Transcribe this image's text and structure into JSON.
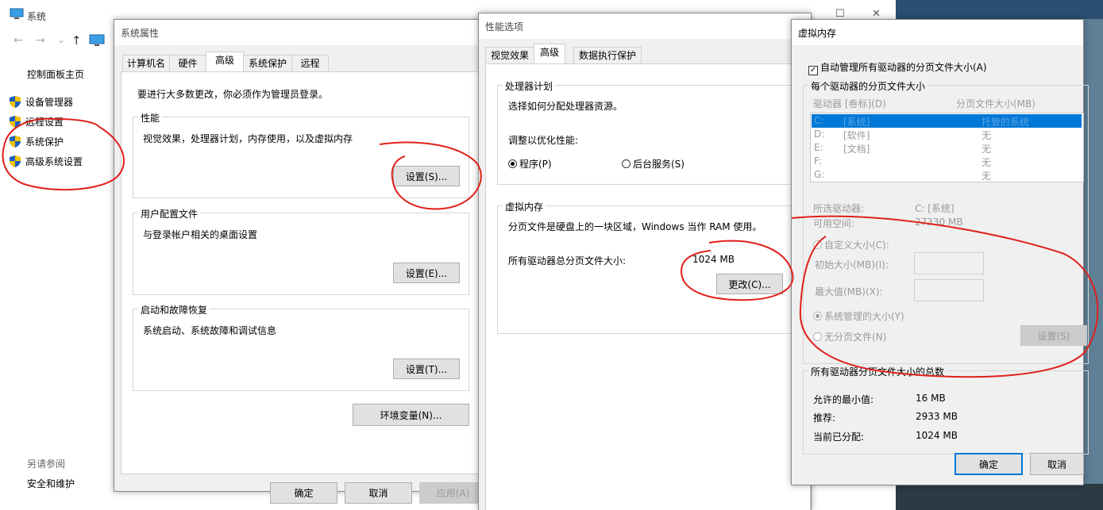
{
  "system_window": {
    "title": "系统",
    "nav": {
      "back": "←",
      "forward": "→",
      "down": "⌄",
      "up": "↑"
    },
    "sidebar": {
      "home": "控制面板主页",
      "items": [
        {
          "label": "设备管理器"
        },
        {
          "label": "远程设置"
        },
        {
          "label": "系统保护"
        },
        {
          "label": "高级系统设置"
        }
      ],
      "see_also": "另请参阅",
      "security": "安全和维护"
    }
  },
  "sysprops": {
    "title": "系统属性",
    "tabs": [
      "计算机名",
      "硬件",
      "高级",
      "系统保护",
      "远程"
    ],
    "admin_note": "要进行大多数更改，你必须作为管理员登录。",
    "performance": {
      "legend": "性能",
      "desc": "视觉效果，处理器计划，内存使用，以及虚拟内存",
      "button": "设置(S)..."
    },
    "user_profiles": {
      "legend": "用户配置文件",
      "desc": "与登录帐户相关的桌面设置",
      "button": "设置(E)..."
    },
    "startup": {
      "legend": "启动和故障恢复",
      "desc": "系统启动、系统故障和调试信息",
      "button": "设置(T)..."
    },
    "env_button": "环境变量(N)...",
    "ok": "确定",
    "cancel": "取消",
    "apply": "应用(A)"
  },
  "perfopts": {
    "title": "性能选项",
    "tabs": [
      "视觉效果",
      "高级",
      "数据执行保护"
    ],
    "processor": {
      "legend": "处理器计划",
      "desc": "选择如何分配处理器资源。",
      "adjust": "调整以优化性能:",
      "opt_programs": "程序(P)",
      "opt_background": "后台服务(S)"
    },
    "vm": {
      "legend": "虚拟内存",
      "desc": "分页文件是硬盘上的一块区域，Windows 当作 RAM 使用。",
      "total_label": "所有驱动器总分页文件大小:",
      "total_value": "1024 MB",
      "change_button": "更改(C)..."
    },
    "window_controls": {
      "minimize": "—",
      "maximize": "☐",
      "close": "✕"
    }
  },
  "vmdlg": {
    "title": "虚拟内存",
    "auto_manage": "自动管理所有驱动器的分页文件大小(A)",
    "per_drive_legend": "每个驱动器的分页文件大小",
    "col_drive": "驱动器 [卷标](D)",
    "col_size": "分页文件大小(MB)",
    "drives": [
      {
        "drive": "C:",
        "label": "[系统]",
        "size": "托管的系统"
      },
      {
        "drive": "D:",
        "label": "[软件]",
        "size": "无"
      },
      {
        "drive": "E:",
        "label": "[文档]",
        "size": "无"
      },
      {
        "drive": "F:",
        "label": "",
        "size": "无"
      },
      {
        "drive": "G:",
        "label": "",
        "size": "无"
      }
    ],
    "selected_drive_label": "所选驱动器:",
    "selected_drive_value": "C: [系统]",
    "free_space_label": "可用空间:",
    "free_space_value": "27330 MB",
    "custom_size": "自定义大小(C):",
    "initial_size": "初始大小(MB)(I):",
    "max_size": "最大值(MB)(X):",
    "system_managed": "系统管理的大小(Y)",
    "no_paging": "无分页文件(N)",
    "set_button": "设置(S)",
    "totals_legend": "所有驱动器分页文件大小的总数",
    "min_allowed_label": "允许的最小值:",
    "min_allowed_value": "16 MB",
    "recommended_label": "推荐:",
    "recommended_value": "2933 MB",
    "current_label": "当前已分配:",
    "current_value": "1024 MB",
    "ok": "确定",
    "cancel": "取消"
  },
  "colors": {
    "selection": "#0078d7",
    "annotation": "#e0201b",
    "shield_blue": "#1f5fbf",
    "shield_yellow": "#f2c200"
  }
}
